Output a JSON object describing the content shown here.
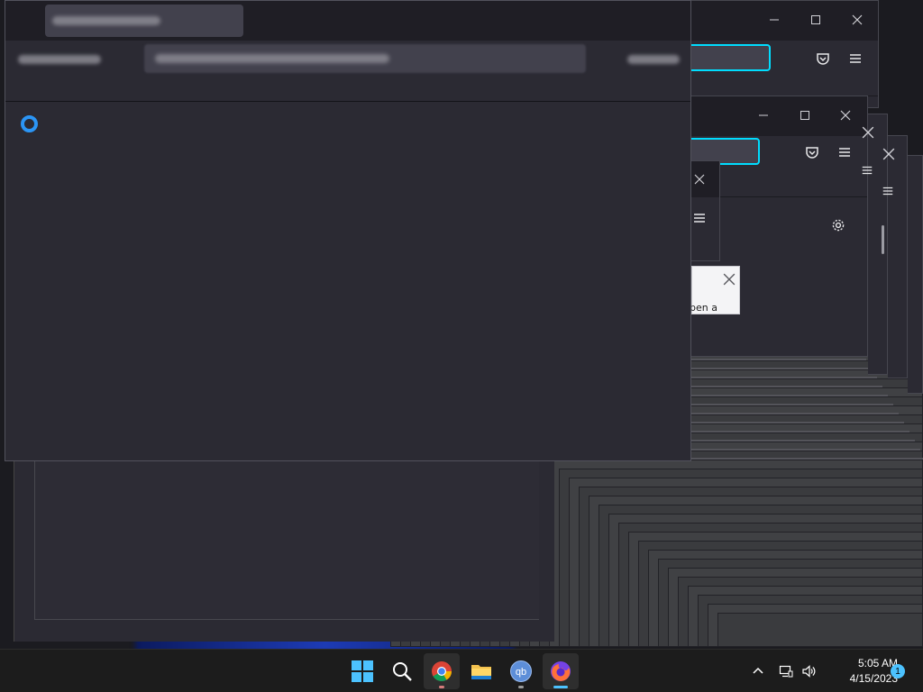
{
  "background_popup": {
    "text": "pen a"
  },
  "taskbar": {
    "apps": [
      {
        "name": "start",
        "icon": "windows-logo-icon"
      },
      {
        "name": "search",
        "icon": "search-icon"
      },
      {
        "name": "chrome",
        "icon": "chrome-icon"
      },
      {
        "name": "file-explorer",
        "icon": "folder-icon"
      },
      {
        "name": "qbittorrent",
        "icon": "qbittorrent-icon",
        "label": "qb"
      },
      {
        "name": "firefox",
        "icon": "firefox-icon"
      }
    ],
    "clock": {
      "time": "5:05 AM",
      "date": "4/15/2023"
    },
    "notifications": {
      "count": "1"
    }
  },
  "colors": {
    "accent": "#00ddff",
    "spinner": "#2b95f5",
    "taskbar_accent": "#4cc2ff",
    "window_bg": "#2b2a33",
    "titlebar_bg": "#1f1e25"
  }
}
